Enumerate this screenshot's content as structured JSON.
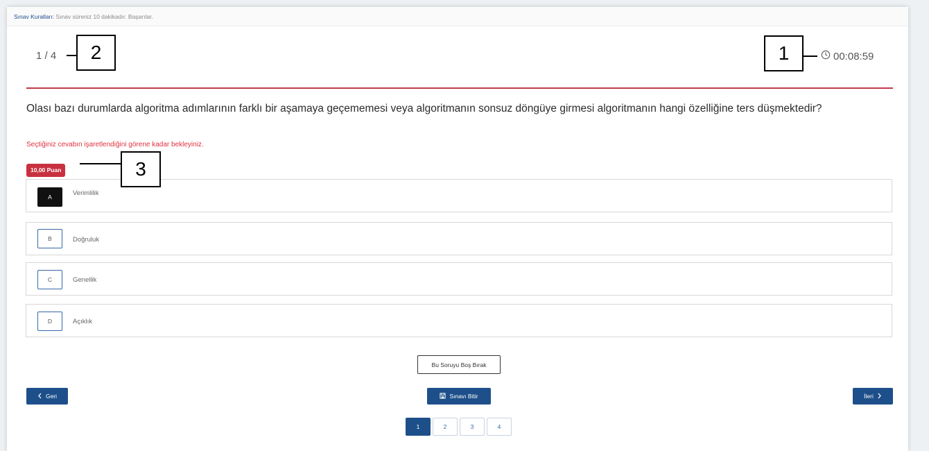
{
  "rules": {
    "label": "Sınav Kuralları:",
    "text": " Sınav süreniz 10 dakikadır. Başarılar."
  },
  "header": {
    "counter": "1 / 4",
    "timer": "00:08:59"
  },
  "question": {
    "text": "Olası bazı durumlarda algoritma adımlarının farklı bir aşamaya geçememesi veya algoritmanın sonsuz döngüye girmesi algoritmanın hangi özelliğine ters düşmektedir?",
    "warning": "Seçtiğiniz cevabın işaretlendiğini görene kadar bekleyiniz.",
    "points": "10,00 Puan"
  },
  "options": [
    {
      "letter": "A",
      "label": "Verimlilik",
      "selected": true
    },
    {
      "letter": "B",
      "label": "Doğruluk",
      "selected": false
    },
    {
      "letter": "C",
      "label": "Genellik",
      "selected": false
    },
    {
      "letter": "D",
      "label": "Açıklık",
      "selected": false
    }
  ],
  "actions": {
    "skip": "Bu Soruyu Boş Bırak",
    "back": "Geri",
    "finish": "Sınavı Bitir",
    "next": "İleri"
  },
  "pagination": {
    "pages": [
      "1",
      "2",
      "3",
      "4"
    ],
    "current": "1"
  },
  "annotations": {
    "one": "1",
    "two": "2",
    "three": "3"
  },
  "colors": {
    "accent_red": "#c0394a",
    "primary_blue": "#1d4f8a",
    "selected_black": "#111111"
  },
  "icons": {
    "timer": "clock-icon",
    "back": "chevron-left-icon",
    "next": "chevron-right-icon",
    "finish": "save-icon"
  }
}
